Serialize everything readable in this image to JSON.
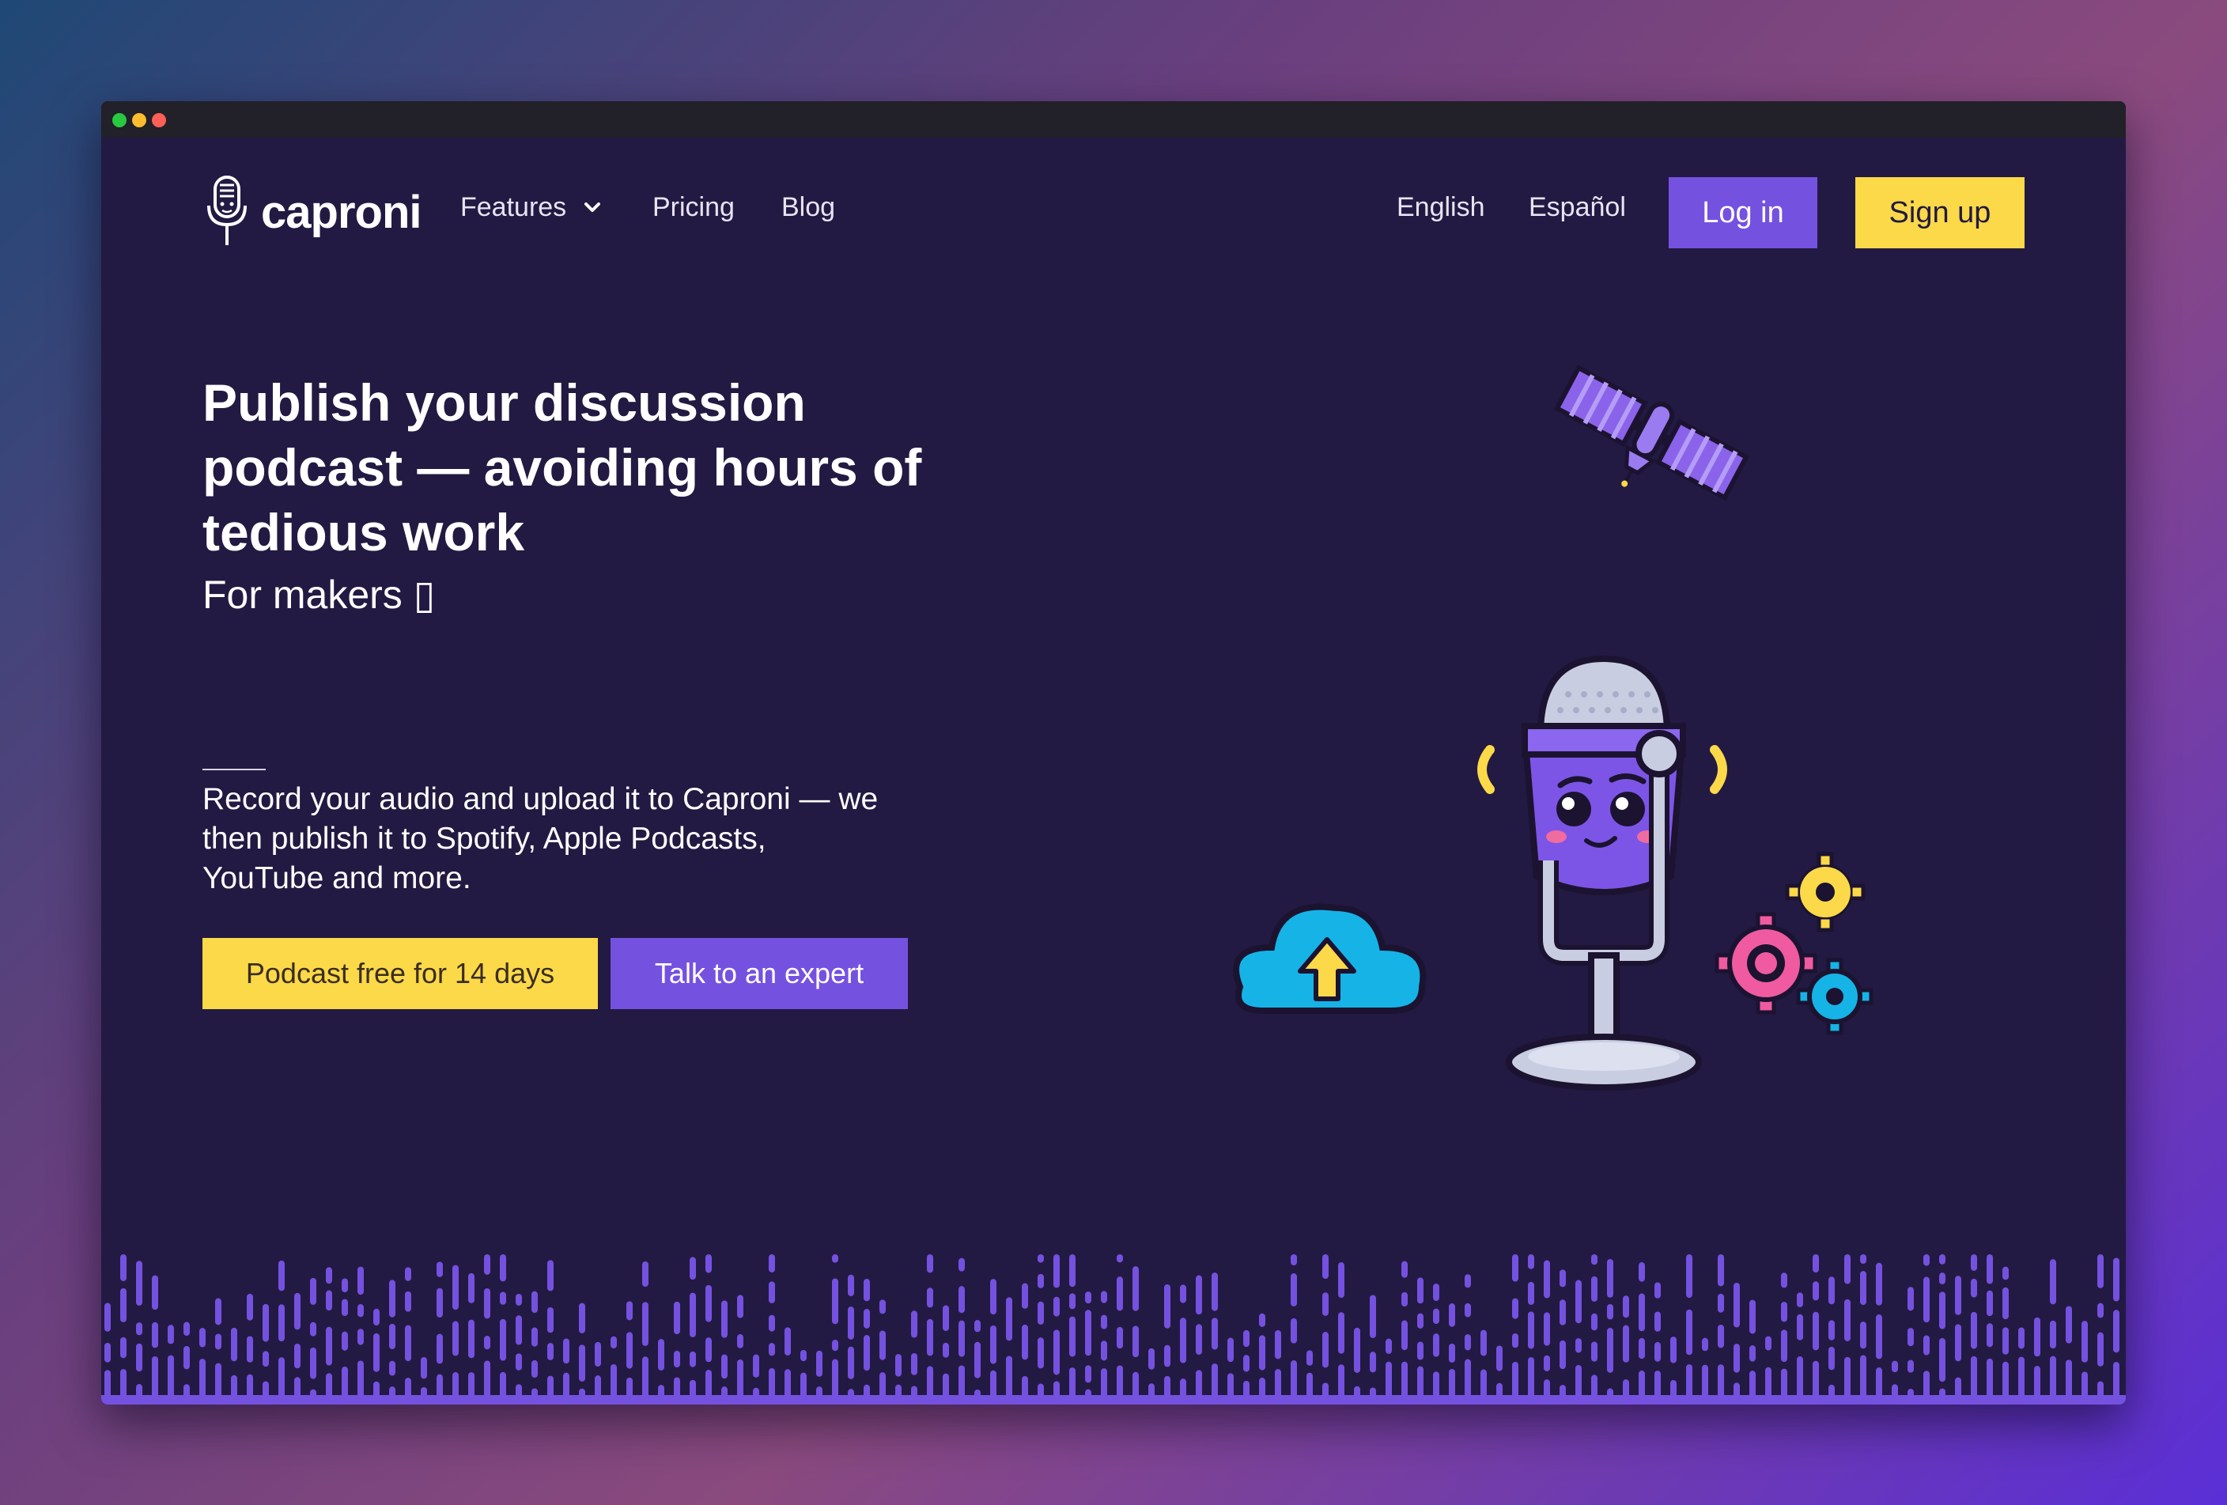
{
  "window": {
    "controls": [
      "green",
      "yellow",
      "red"
    ]
  },
  "nav": {
    "logo_text": "caproni",
    "features_label": "Features",
    "pricing_label": "Pricing",
    "blog_label": "Blog",
    "english_label": "English",
    "espanol_label": "Español",
    "login_label": "Log in",
    "signup_label": "Sign up"
  },
  "hero": {
    "headline": "Publish your discussion podcast — avoiding hours of tedious work",
    "subhead": "For makers ▯",
    "description": "Record your audio and upload it to Caproni — we then publish it to Spotify, Apple Podcasts, YouTube and more.",
    "primary_cta": "Podcast free for 14 days",
    "secondary_cta": "Talk to an expert"
  },
  "icons": {
    "logo": "microphone-face-icon",
    "features_dropdown": "chevron-down-icon",
    "illustration": "microphone-mascot-illustration",
    "satellite": "satellite-icon",
    "cloud": "cloud-upload-icon",
    "gears": "gears-icon",
    "waveform": "audio-waveform-decoration"
  },
  "colors": {
    "background": "#221a42",
    "accent_purple": "#7551e0",
    "accent_yellow": "#fbd949",
    "text": "#ffffff"
  }
}
